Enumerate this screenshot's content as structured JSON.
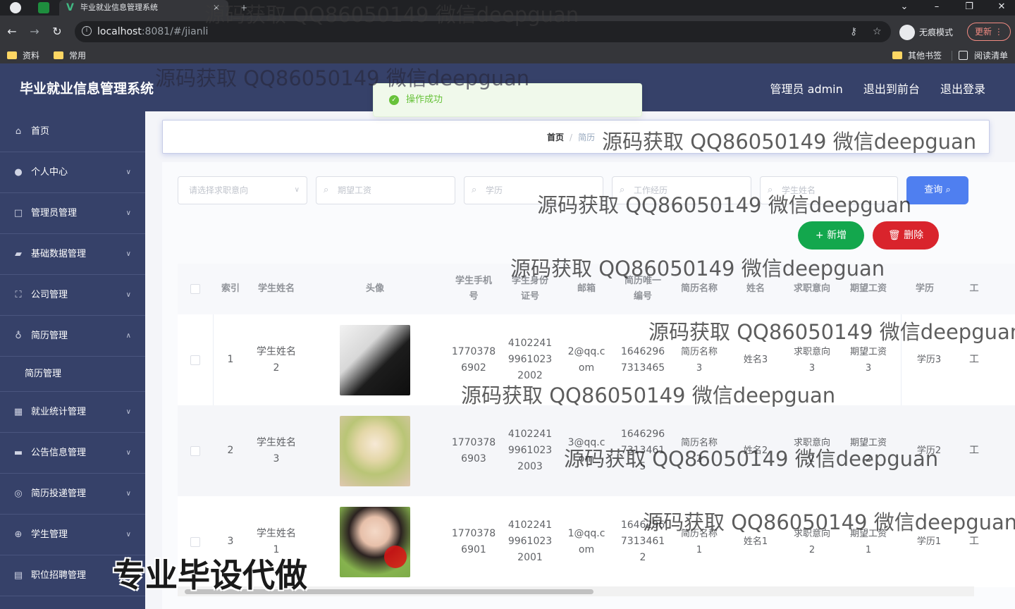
{
  "browser": {
    "tab_title": "毕业就业信息管理系统",
    "new_tab": "+",
    "tab_close": "✕",
    "url_host": "localhost",
    "url_rest": ":8081/#/jianli",
    "incognito_label": "无痕模式",
    "update_label": "更新",
    "bookmarks": [
      "资料",
      "常用"
    ],
    "bookmarks_right": [
      "其他书签",
      "阅读清单"
    ]
  },
  "app": {
    "title": "毕业就业信息管理系统",
    "header_links": [
      "管理员 admin",
      "退出到前台",
      "退出登录"
    ]
  },
  "sidebar": {
    "items": [
      {
        "label": "首页",
        "icon": "home-icon"
      },
      {
        "label": "个人中心",
        "icon": "user-icon"
      },
      {
        "label": "管理员管理",
        "icon": "square-icon"
      },
      {
        "label": "基础数据管理",
        "icon": "data-icon"
      },
      {
        "label": "公司管理",
        "icon": "frame-icon"
      },
      {
        "label": "简历管理",
        "icon": "mic-icon"
      },
      {
        "label": "简历管理",
        "icon": ""
      },
      {
        "label": "就业统计管理",
        "icon": "stats-icon"
      },
      {
        "label": "公告信息管理",
        "icon": "notice-icon"
      },
      {
        "label": "简历投递管理",
        "icon": "target-icon"
      },
      {
        "label": "学生管理",
        "icon": "globe-icon"
      },
      {
        "label": "职位招聘管理",
        "icon": "doc-icon"
      }
    ]
  },
  "breadcrumb": {
    "home": "首页",
    "current": "简历"
  },
  "toast": {
    "message": "操作成功"
  },
  "filters": {
    "intent_placeholder": "请选择求职意向",
    "salary_placeholder": "期望工资",
    "education_placeholder": "学历",
    "experience_placeholder": "工作经历",
    "student_name_placeholder": "学生姓名"
  },
  "buttons": {
    "query": "查询",
    "add": "+ 新增",
    "delete": "删除"
  },
  "table": {
    "headers": [
      "索引",
      "学生姓名",
      "头像",
      "学生手机\n号",
      "学生身份\n证号",
      "邮箱",
      "简历唯一\n编号",
      "简历名称",
      "姓名",
      "求职意向",
      "期望工资",
      "学历",
      "工"
    ],
    "rows": [
      {
        "index": "1",
        "student_name": "学生姓名\n2",
        "phone": "1770378\n6902",
        "id_card": "4102241\n9961023\n2002",
        "email": "2@qq.c\nom",
        "resume_no": "1646296\n7313465",
        "resume_name": "简历名称\n3",
        "name": "姓名3",
        "intent": "求职意向\n3",
        "salary": "期望工资\n3",
        "education": "学历3",
        "more": "工"
      },
      {
        "index": "2",
        "student_name": "学生姓名\n3",
        "phone": "1770378\n6903",
        "id_card": "4102241\n9961023\n2003",
        "email": "3@qq.c\nom",
        "resume_no": "1646296\n7313461\n5",
        "resume_name": "简历名称\n2",
        "name": "姓名2",
        "intent": "求职意向\n2",
        "salary": "期望工资\n2",
        "education": "学历2",
        "more": "工"
      },
      {
        "index": "3",
        "student_name": "学生姓名\n1",
        "phone": "1770378\n6901",
        "id_card": "4102241\n9961023\n2001",
        "email": "1@qq.c\nom",
        "resume_no": "1646296\n7313461\n2",
        "resume_name": "简历名称\n1",
        "name": "姓名1",
        "intent": "求职意向\n2",
        "salary": "期望工资\n1",
        "education": "学历1",
        "more": "工"
      }
    ]
  },
  "watermarks": {
    "text": "源码获取 QQ86050149 微信deepguan",
    "promo": "专业毕设代做"
  }
}
